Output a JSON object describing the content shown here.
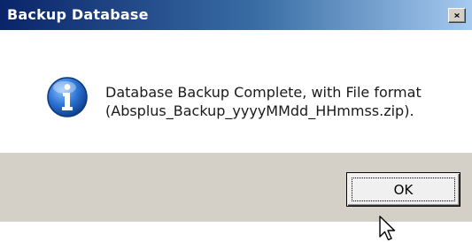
{
  "dialog": {
    "title": "Backup Database",
    "close_label": "×",
    "icon": "info-icon",
    "message_line1": "Database Backup Complete, with File format",
    "message_line2": "(Absplus_Backup_yyyyMMdd_HHmmss.zip).",
    "ok_label": "OK"
  },
  "colors": {
    "titlebar_start": "#0a246a",
    "titlebar_end": "#a6caf0",
    "footer_bg": "#d4d0c8",
    "icon_blue": "#1f5fb8"
  },
  "pointer": "arrow-cursor-icon"
}
